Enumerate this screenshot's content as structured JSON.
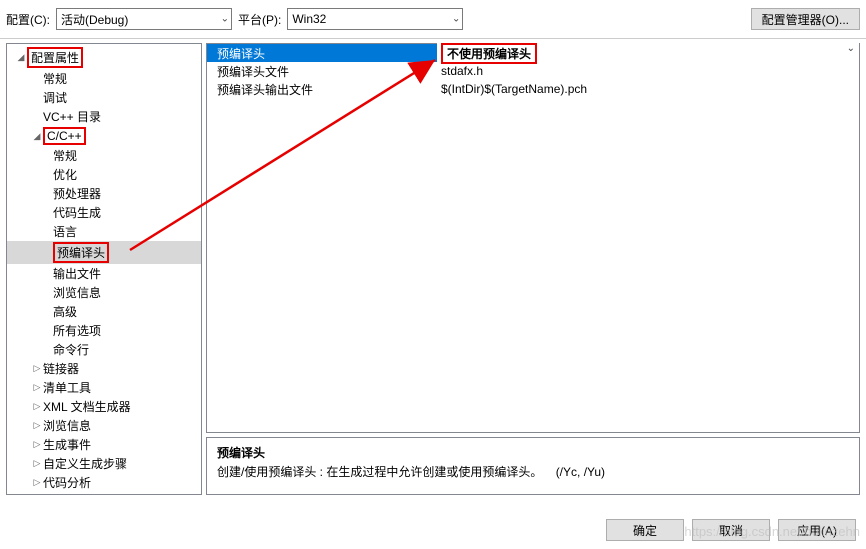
{
  "topbar": {
    "config_label": "配置(C):",
    "config_value": "活动(Debug)",
    "platform_label": "平台(P):",
    "platform_value": "Win32",
    "manager_btn": "配置管理器(O)..."
  },
  "tree": {
    "root": "配置属性",
    "items_l1_a": [
      "常规",
      "调试",
      "VC++ 目录"
    ],
    "cpp": "C/C++",
    "cpp_children": [
      "常规",
      "优化",
      "预处理器",
      "代码生成",
      "语言",
      "预编译头",
      "输出文件",
      "浏览信息",
      "高级",
      "所有选项",
      "命令行"
    ],
    "items_l1_b": [
      "链接器",
      "清单工具",
      "XML 文档生成器",
      "浏览信息",
      "生成事件",
      "自定义生成步骤",
      "代码分析"
    ]
  },
  "grid": {
    "rows": [
      {
        "label": "预编译头",
        "value": "不使用预编译头"
      },
      {
        "label": "预编译头文件",
        "value": "stdafx.h"
      },
      {
        "label": "预编译头输出文件",
        "value": "$(IntDir)$(TargetName).pch"
      }
    ]
  },
  "desc": {
    "title": "预编译头",
    "body": "创建/使用预编译头 : 在生成过程中允许创建或使用预编译头。",
    "flags": "(/Yc, /Yu)"
  },
  "footer": {
    "ok": "确定",
    "cancel": "取消",
    "apply": "应用(A)"
  },
  "watermark": "https://blog.csdn.net/hulinzehn"
}
